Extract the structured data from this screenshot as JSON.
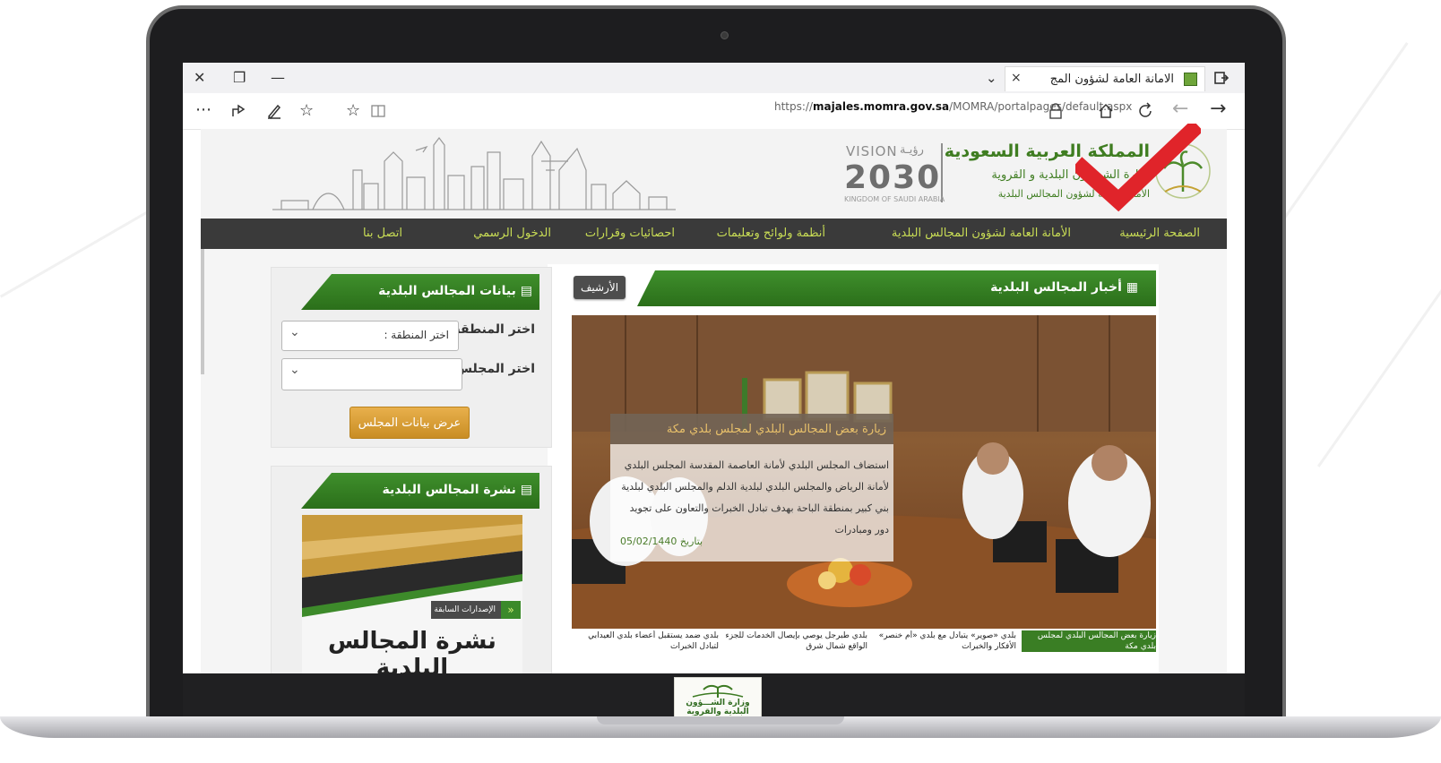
{
  "browser": {
    "tab_title": "الامانة العامة لشؤون المج",
    "tab_close": "×",
    "new_tab": "+",
    "tab_menu": "⌄",
    "url_prefix": "https://",
    "url_host": "majales.momra.gov.sa",
    "url_path": "/MOMRA/portalpages/default.aspx",
    "window_controls": [
      "✕",
      "❐",
      "—"
    ],
    "toolbar_icons": [
      "more-icon",
      "share-icon",
      "pen-icon",
      "favorites-icon",
      "star-icon",
      "reading-view-icon",
      "lock-icon",
      "home-icon",
      "refresh-icon",
      "back-icon",
      "forward-icon"
    ]
  },
  "header": {
    "kingdom": "المملكة العربية السعودية",
    "ministry_line": "وزارة الشـــؤون البلدية و القروية",
    "secretariat_line": "الأمانة العامة لشؤون المجالس البلدية",
    "vision_word": "VISION",
    "vision_arabic": "رؤيـة",
    "vision_year": "2030",
    "vision_small": "KINGDOM OF SAUDI ARABIA"
  },
  "nav": {
    "items": [
      "الصفحة الرئيسية",
      "الأمانة العامة لشؤون المجالس البلدية",
      "أنظمة ولوائح وتعليمات",
      "احصائيات وقرارات",
      "الدخول الرسمي",
      "اتصل بنا"
    ]
  },
  "news": {
    "heading": "أخبار المجالس البلدية",
    "archive": "الأرشيف",
    "feature_title": "زيارة بعض المجالس البلدي لمجلس بلدي مكة",
    "feature_body": "استضاف المجلس البلدي لأمانة العاصمة المقدسة المجلس البلدي لأمانة الرياض والمجلس البلدي لبلدية الدلم والمجلس البلدي لبلدية بني كبير بمنطقة الباحة بهدف تبادل الخبرات والتعاون على تجويد دور ومبادرات",
    "feature_date_label": "بتاريخ",
    "feature_date": "05/02/1440",
    "ticker": [
      "زيارة بعض المجالس البلدي لمجلس بلدي مكة",
      "بلدي «صوير» يتبادل مع بلدي «أم خنصر» الأفكار والخبرات",
      "بلدي طبرجل يوصي بإيصال الخدمات للجزء الواقع شمال شرق",
      "بلدي ضمد يستقبل أعضاء بلدي العيدابي لتبادل الخبرات"
    ]
  },
  "council_data": {
    "heading": "بيانات المجالس البلدية",
    "region_label": "اختر المنطقة",
    "region_value": "اختر المنطقة :",
    "council_label": "اختر المجلس",
    "council_value": "",
    "show_button": "عرض بيانات المجلس"
  },
  "bulletin": {
    "heading": "نشرة المجالس البلدية",
    "issues_tag": "الإصدارات السابقة",
    "title": "نشرة المجالس البلدية"
  },
  "ministry_footer": {
    "line1": "وزارة الشـــؤون",
    "line2": "البلدية والقروية"
  },
  "colors": {
    "brand_green": "#3f7d21",
    "nav_bg": "#3a3a3a",
    "nav_text": "#c9dd55",
    "gold": "#d79b2e",
    "checkmark": "#e0242a"
  }
}
